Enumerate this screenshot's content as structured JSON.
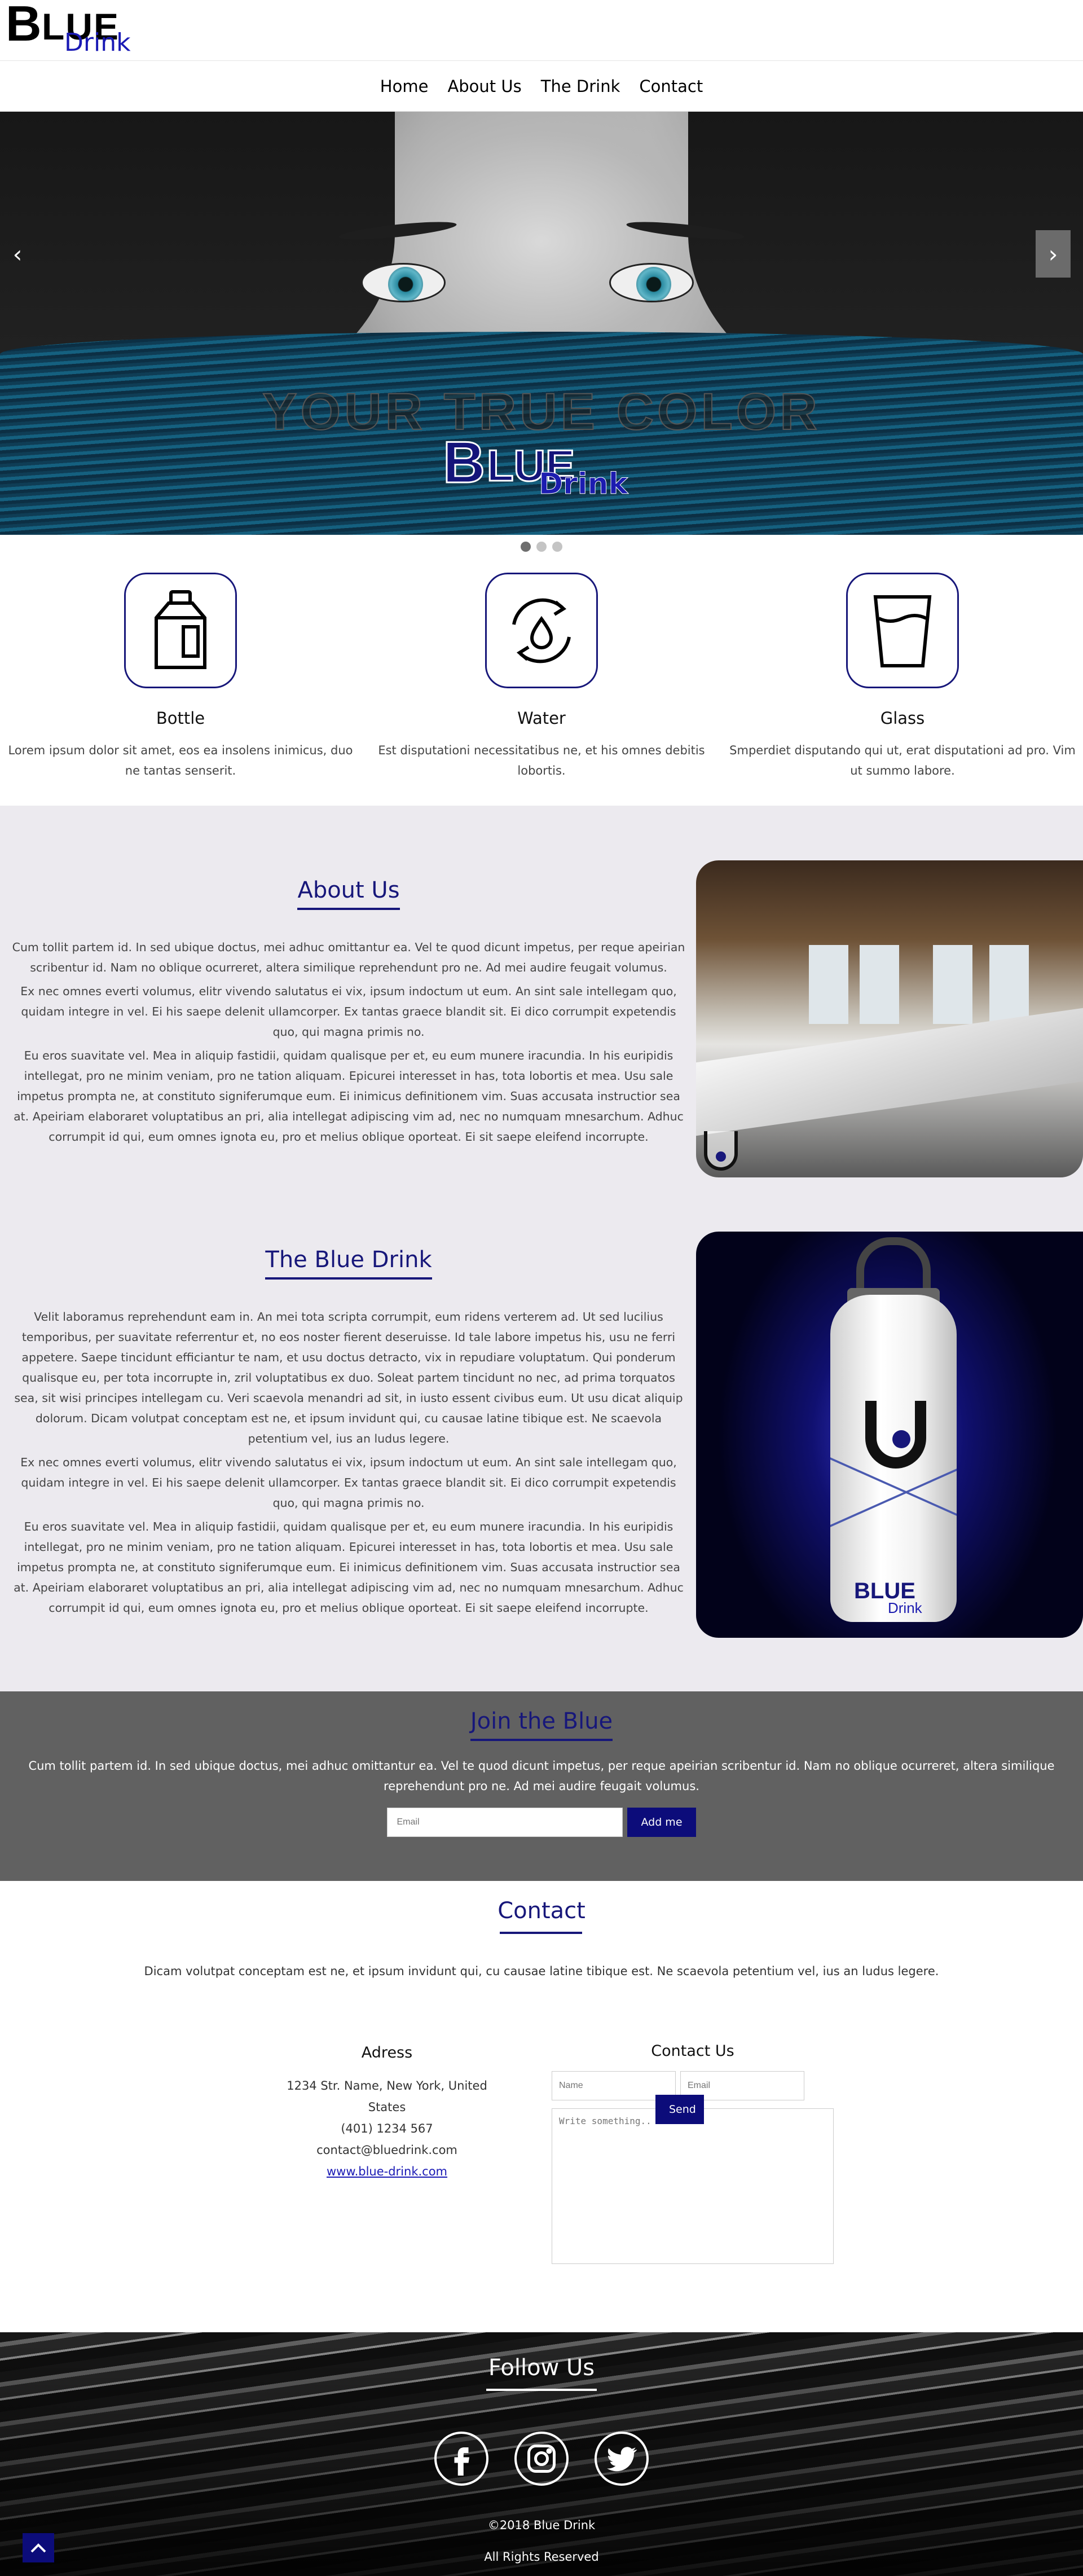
{
  "logo": {
    "big": "B",
    "rest": "LUE",
    "sub": "Drink"
  },
  "nav": [
    "Home",
    "About Us",
    "The Drink",
    "Contact"
  ],
  "hero": {
    "tagline": "YOUR TRUE COLOR",
    "logo_main": "B",
    "logo_rest": "LUE",
    "logo_sub": "Drink",
    "prev": "‹",
    "next": "›",
    "slide_count": 3,
    "active_slide": 1
  },
  "features": [
    {
      "icon": "bottle-icon",
      "title": "Bottle",
      "text": "Lorem ipsum dolor sit amet, eos ea insolens inimicus, duo ne tantas senserit."
    },
    {
      "icon": "water-cycle-icon",
      "title": "Water",
      "text": "Est disputationi necessitatibus ne, et his omnes debitis lobortis."
    },
    {
      "icon": "glass-icon",
      "title": "Glass",
      "text": "Smperdiet disputando qui ut, erat disputationi ad pro. Vim ut summo labore."
    }
  ],
  "about": {
    "title": "About Us",
    "paragraphs": [
      "Cum tollit partem id. In sed ubique doctus, mei adhuc omittantur ea. Vel te quod dicunt impetus, per reque apeirian scribentur id. Nam no oblique ocurreret, altera similique reprehendunt pro ne. Ad mei audire feugait volumus.",
      "Ex nec omnes everti volumus, elitr vivendo salutatus ei vix, ipsum indoctum ut eum. An sint sale intellegam quo, quidam integre in vel. Ei his saepe delenit ullamcorper. Ex tantas graece blandit sit. Ei dico corrumpit expetendis quo, qui magna primis no.",
      "Eu eros suavitate vel. Mea in aliquip fastidii, quidam qualisque per et, eu eum munere iracundia. In his euripidis intellegat, pro ne minim veniam, pro ne tation aliquam. Epicurei interesset in has, tota lobortis et mea. Usu sale impetus prompta ne, at constituto signiferumque eum. Ei inimicus definitionem vim. Suas accusata instructior sea at. Apeiriam elaboraret voluptatibus an pri, alia intellegat adipiscing vim ad, nec no numquam mnesarchum. Adhuc corrumpit id qui, eum omnes ignota eu, pro et melius oblique oporteat. Ei sit saepe eleifend incorrupte."
    ]
  },
  "drink": {
    "title": "The Blue Drink",
    "paragraphs": [
      "Velit laboramus reprehendunt eam in. An mei tota scripta corrumpit, eum ridens verterem ad. Ut sed lucilius temporibus, per suavitate referrentur et, no eos noster fierent deseruisse. Id tale labore impetus his, usu ne ferri appetere. Saepe tincidunt efficiantur te nam, et usu doctus detracto, vix in repudiare voluptatum. Qui ponderum qualisque eu, per tota incorrupte in, zril voluptatibus ex duo. Soleat partem tincidunt no nec, ad prima torquatos sea, sit wisi principes intellegam cu. Veri scaevola menandri ad sit, in iusto essent civibus eum. Ut usu dicat aliquip dolorum. Dicam volutpat conceptam est ne, et ipsum invidunt qui, cu causae latine tibique est. Ne scaevola petentium vel, ius an ludus legere.",
      "Ex nec omnes everti volumus, elitr vivendo salutatus ei vix, ipsum indoctum ut eum. An sint sale intellegam quo, quidam integre in vel. Ei his saepe delenit ullamcorper. Ex tantas graece blandit sit. Ei dico corrumpit expetendis quo, qui magna primis no.",
      "Eu eros suavitate vel. Mea in aliquip fastidii, quidam qualisque per et, eu eum munere iracundia. In his euripidis intellegat, pro ne minim veniam, pro ne tation aliquam. Epicurei interesset in has, tota lobortis et mea. Usu sale impetus prompta ne, at constituto signiferumque eum. Ei inimicus definitionem vim. Suas accusata instructior sea at. Apeiriam elaboraret voluptatibus an pri, alia intellegat adipiscing vim ad, nec no numquam mnesarchum. Adhuc corrumpit id qui, eum omnes ignota eu, pro et melius oblique oporteat. Ei sit saepe eleifend incorrupte."
    ],
    "bottle_label": "BLUE",
    "bottle_sub": "Drink"
  },
  "join": {
    "title": "Join the Blue",
    "text": "Cum tollit partem id. In sed ubique doctus, mei adhuc omittantur ea. Vel te quod dicunt impetus, per reque apeirian scribentur id. Nam no oblique ocurreret, altera similique reprehendunt pro ne. Ad mei audire feugait volumus.",
    "email_placeholder": "Email",
    "button": "Add me"
  },
  "contact": {
    "title": "Contact",
    "intro": "Dicam volutpat conceptam est ne, et ipsum invidunt qui, cu causae latine tibique est. Ne scaevola petentium vel, ius an ludus legere.",
    "address_title": "Adress",
    "address": "1234 Str. Name, New York, United States",
    "phone": "(401) 1234 567",
    "email": "contact@bluedrink.com",
    "website": "www.blue-drink.com",
    "form_title": "Contact Us",
    "name_placeholder": "Name",
    "email_placeholder": "Email",
    "message_placeholder": "Write something..",
    "send": "Send"
  },
  "footer": {
    "title": "Follow Us",
    "socials": [
      "facebook-icon",
      "instagram-icon",
      "twitter-icon"
    ],
    "copyright": "©2018 Blue Drink",
    "rights": "All Rights Reserved"
  },
  "colors": {
    "brand": "#17177a",
    "accent": "#1a1ab5",
    "join_bg": "#616161",
    "section_bg": "#eceaef"
  }
}
